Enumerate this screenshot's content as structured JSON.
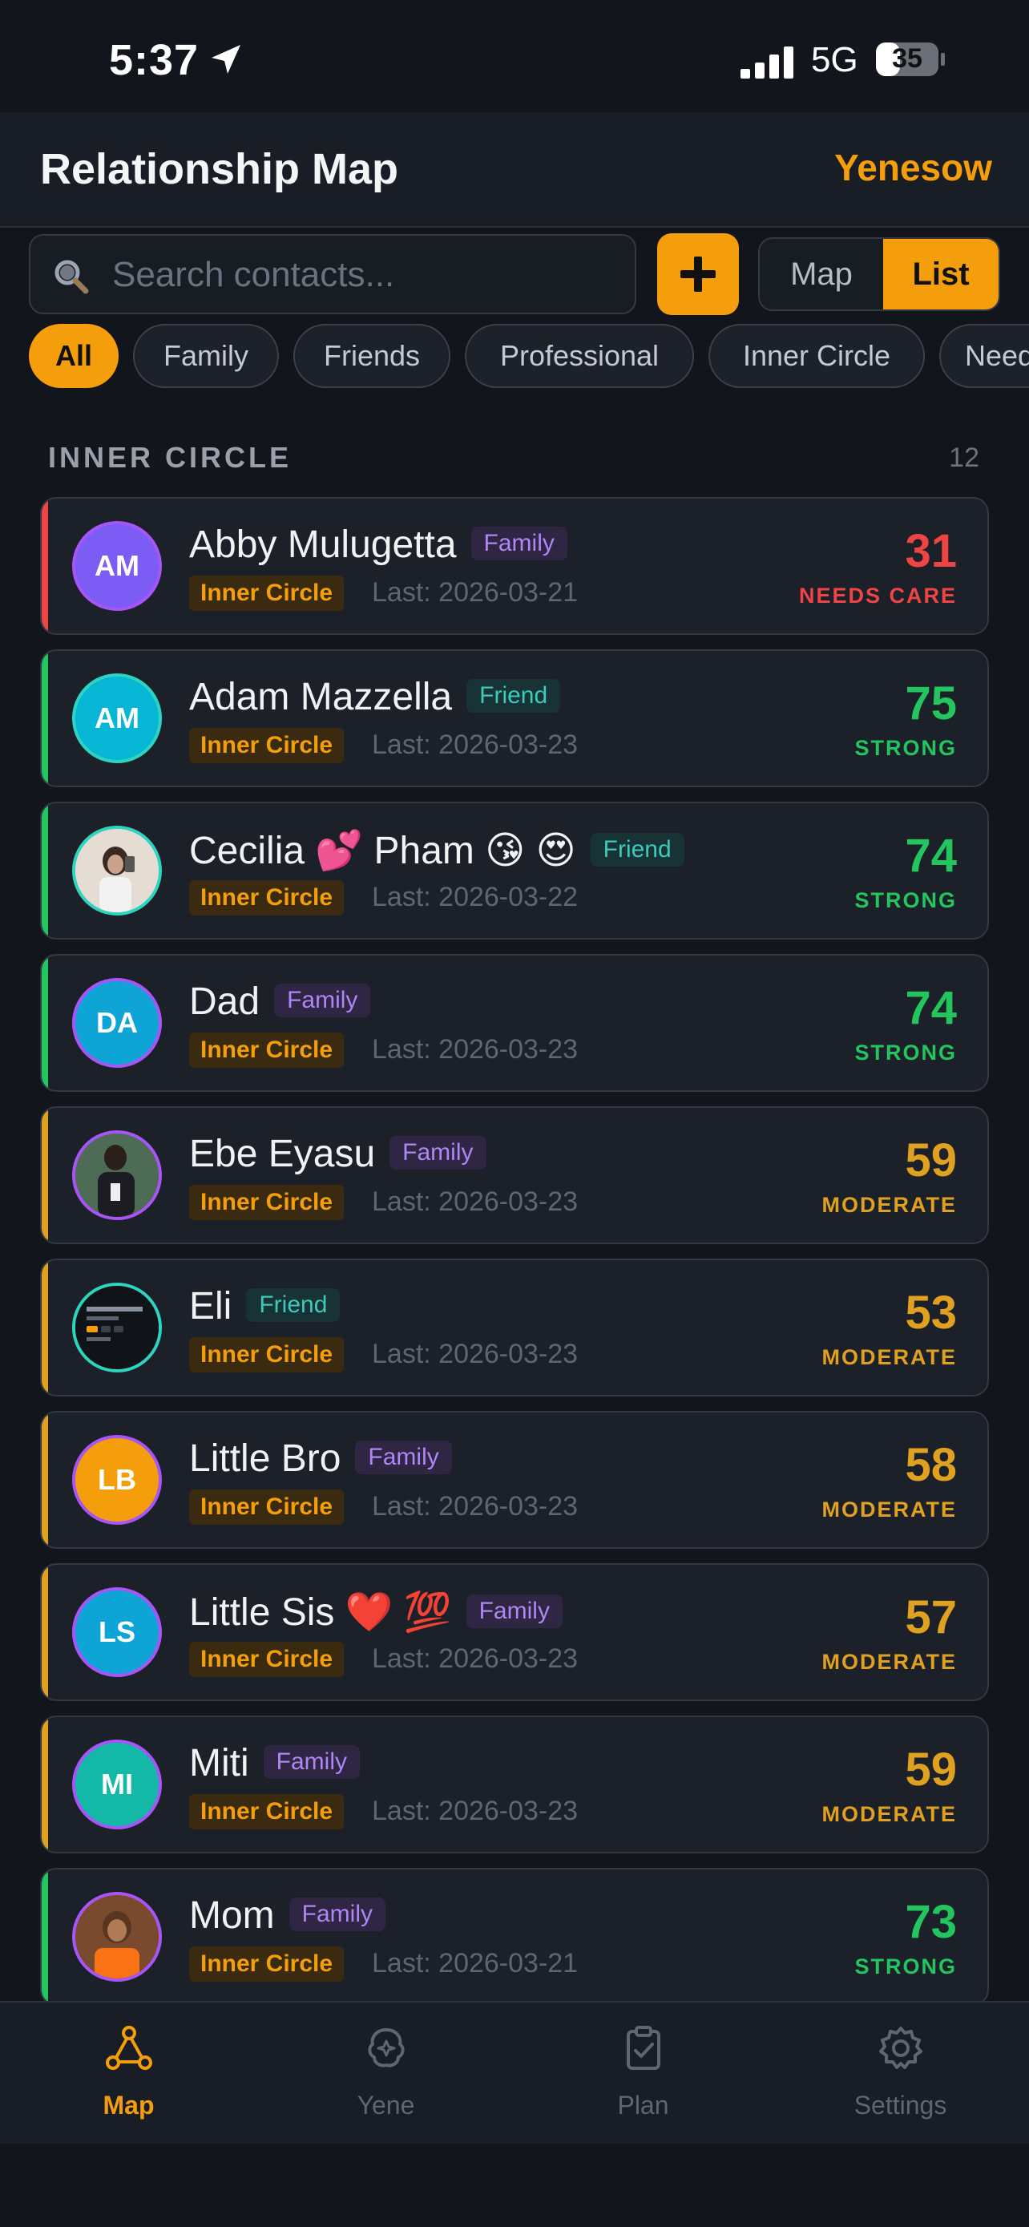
{
  "status_bar": {
    "time": "5:37",
    "network": "5G",
    "battery": "35"
  },
  "header": {
    "title": "Relationship Map",
    "profile": "Yenesow"
  },
  "search": {
    "placeholder": "Search contacts..."
  },
  "add_button": {
    "label": "+"
  },
  "view_toggle": {
    "map": "Map",
    "list": "List",
    "selected": "List"
  },
  "filters": [
    "All",
    "Family",
    "Friends",
    "Professional",
    "Inner Circle",
    "Needs"
  ],
  "section": {
    "title": "INNER CIRCLE",
    "count": "12"
  },
  "contacts": [
    {
      "initials": "AM",
      "name": "Abby Mulugetta",
      "relation": "Family",
      "circle": "Inner Circle",
      "last": "Last: 2026-03-21",
      "score": "31",
      "status": "NEEDS CARE"
    },
    {
      "initials": "AM",
      "name": "Adam Mazzella",
      "relation": "Friend",
      "circle": "Inner Circle",
      "last": "Last: 2026-03-23",
      "score": "75",
      "status": "STRONG"
    },
    {
      "initials": "",
      "name": "Cecilia 💕 Pham 😘 😍",
      "relation": "Friend",
      "circle": "Inner Circle",
      "last": "Last: 2026-03-22",
      "score": "74",
      "status": "STRONG"
    },
    {
      "initials": "DA",
      "name": "Dad",
      "relation": "Family",
      "circle": "Inner Circle",
      "last": "Last: 2026-03-23",
      "score": "74",
      "status": "STRONG"
    },
    {
      "initials": "",
      "name": "Ebe Eyasu",
      "relation": "Family",
      "circle": "Inner Circle",
      "last": "Last: 2026-03-23",
      "score": "59",
      "status": "MODERATE"
    },
    {
      "initials": "",
      "name": "Eli",
      "relation": "Friend",
      "circle": "Inner Circle",
      "last": "Last: 2026-03-23",
      "score": "53",
      "status": "MODERATE"
    },
    {
      "initials": "LB",
      "name": "Little Bro",
      "relation": "Family",
      "circle": "Inner Circle",
      "last": "Last: 2026-03-23",
      "score": "58",
      "status": "MODERATE"
    },
    {
      "initials": "LS",
      "name": "Little Sis ❤️ 💯",
      "relation": "Family",
      "circle": "Inner Circle",
      "last": "Last: 2026-03-23",
      "score": "57",
      "status": "MODERATE"
    },
    {
      "initials": "MI",
      "name": "Miti",
      "relation": "Family",
      "circle": "Inner Circle",
      "last": "Last: 2026-03-23",
      "score": "59",
      "status": "MODERATE"
    },
    {
      "initials": "",
      "name": "Mom",
      "relation": "Family",
      "circle": "Inner Circle",
      "last": "Last: 2026-03-21",
      "score": "73",
      "status": "STRONG"
    }
  ],
  "tabs": [
    {
      "label": "Map",
      "icon": "graph-icon",
      "active": true
    },
    {
      "label": "Yene",
      "icon": "brain-icon",
      "active": false
    },
    {
      "label": "Plan",
      "icon": "clipboard-check-icon",
      "active": false
    },
    {
      "label": "Settings",
      "icon": "gear-icon",
      "active": false
    }
  ],
  "colors": {
    "accent": "#f59e0b",
    "needs_care": "#ef4444",
    "strong": "#22c55e",
    "moderate": "#e0a020",
    "family_tag": "#b085f5",
    "friend_tag": "#3ec9bb"
  }
}
